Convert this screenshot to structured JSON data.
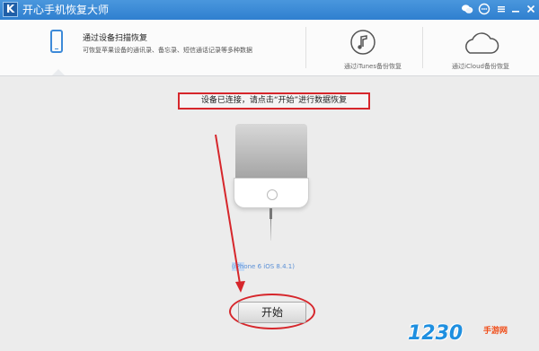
{
  "window": {
    "title": "开心手机恢复大师",
    "logo_letter": "K"
  },
  "window_controls": [
    "wechat-icon",
    "message-icon",
    "menu-icon",
    "minimize-icon",
    "close-icon"
  ],
  "tabs": [
    {
      "title": "通过设备扫描恢复",
      "desc": "可恢复苹果设备的通讯录、备忘录、短信通话记录等多种数据",
      "icon": "phone-icon",
      "active": true
    },
    {
      "label": "通过iTunes备份恢复",
      "icon": "music-note-icon",
      "active": false
    },
    {
      "label": "通过iCloud备份恢复",
      "icon": "cloud-icon",
      "active": false
    }
  ],
  "notice": "设备已连接，请点击“开始”进行数据恢复",
  "device_model": "(iPhone 6 iOS 8.4.1)",
  "start_button": "开始",
  "watermark": {
    "number": "1230",
    "text": "手游网"
  },
  "colors": {
    "accent": "#3d8ad8",
    "highlight": "#d6262b",
    "titlebar": "#3a8ad6"
  }
}
